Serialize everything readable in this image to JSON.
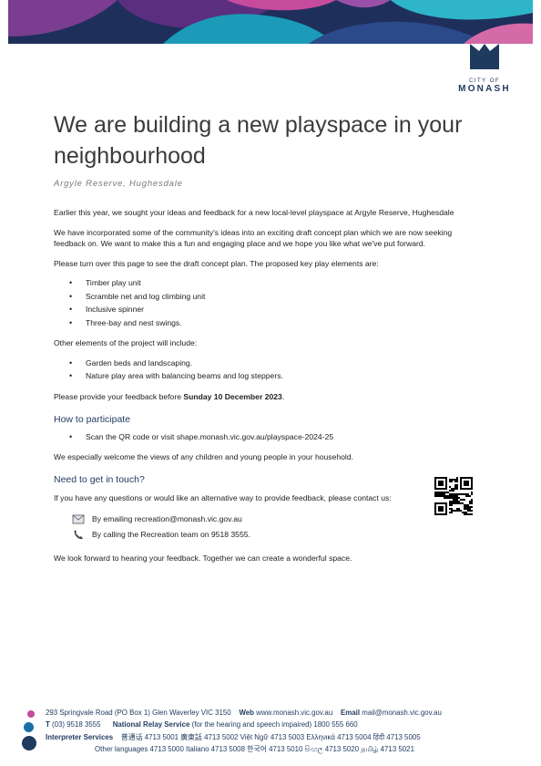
{
  "header": {
    "logo_top": "CITY OF",
    "logo_name": "MONASH"
  },
  "main": {
    "title": "We are building a new playspace in your neighbourhood",
    "subtitle": "Argyle Reserve, Hughesdale",
    "intro1": "Earlier this year, we sought your ideas and feedback for a new local-level playspace at Argyle Reserve, Hughesdale",
    "intro2": "We have incorporated some of the community's ideas into an exciting draft concept plan which we are now seeking feedback on. We want to make this a fun and engaging place and we hope you like what we've put forward.",
    "intro3": "Please turn over this page to see the draft concept plan. The proposed key play elements are:",
    "key_elements": [
      "Timber play unit",
      "Scramble net and log climbing unit",
      "Inclusive spinner",
      "Three-bay and nest swings."
    ],
    "other_intro": "Other elements of the project will include:",
    "other_elements": [
      "Garden beds and landscaping.",
      "Nature play area with balancing beams and log steppers."
    ],
    "deadline_prefix": "Please provide your feedback before ",
    "deadline_date": "Sunday 10 December 2023",
    "deadline_suffix": ".",
    "participate_heading": "How to participate",
    "participate_item": "Scan the QR code or visit shape.monash.vic.gov.au/playspace-2024-25",
    "welcome": "We especially welcome the views of any children and young people in your household.",
    "touch_heading": "Need to get in touch?",
    "touch_text": "If you have any questions or would like an alternative way to provide feedback, please contact us:",
    "email_line": "By emailing recreation@monash.vic.gov.au",
    "phone_line": "By calling the Recreation team on 9518 3555.",
    "closing": "We look forward to hearing your feedback. Together we can create a wonderful space."
  },
  "footer": {
    "address": "293 Springvale Road (PO Box 1) Glen Waverley VIC 3150",
    "web_label": "Web",
    "web": "www.monash.vic.gov.au",
    "email_label": "Email",
    "email": "mail@monash.vic.gov.au",
    "t_label": "T",
    "phone": "(03) 9518 3555",
    "nrs_label": "National Relay Service",
    "nrs_text": "(for the hearing and speech impaired)  1800 555 660",
    "interp_label": "Interpreter Services",
    "languages_row1": "普通话  4713 5001   廣東話  4713 5002   Việt Ngữ  4713 5003   Ελληνικά  4713 5004   हिंदी  4713 5005",
    "languages_row2": "Other languages  4713 5000   Italiano  4713 5008   한국어  4713 5010   සිංහල  4713 5020   தமிழ்  4713 5021"
  },
  "colors": {
    "navy": "#1f3a5f",
    "teal": "#1b9bb8",
    "purple": "#7a3d8f",
    "magenta": "#c64b9d"
  }
}
